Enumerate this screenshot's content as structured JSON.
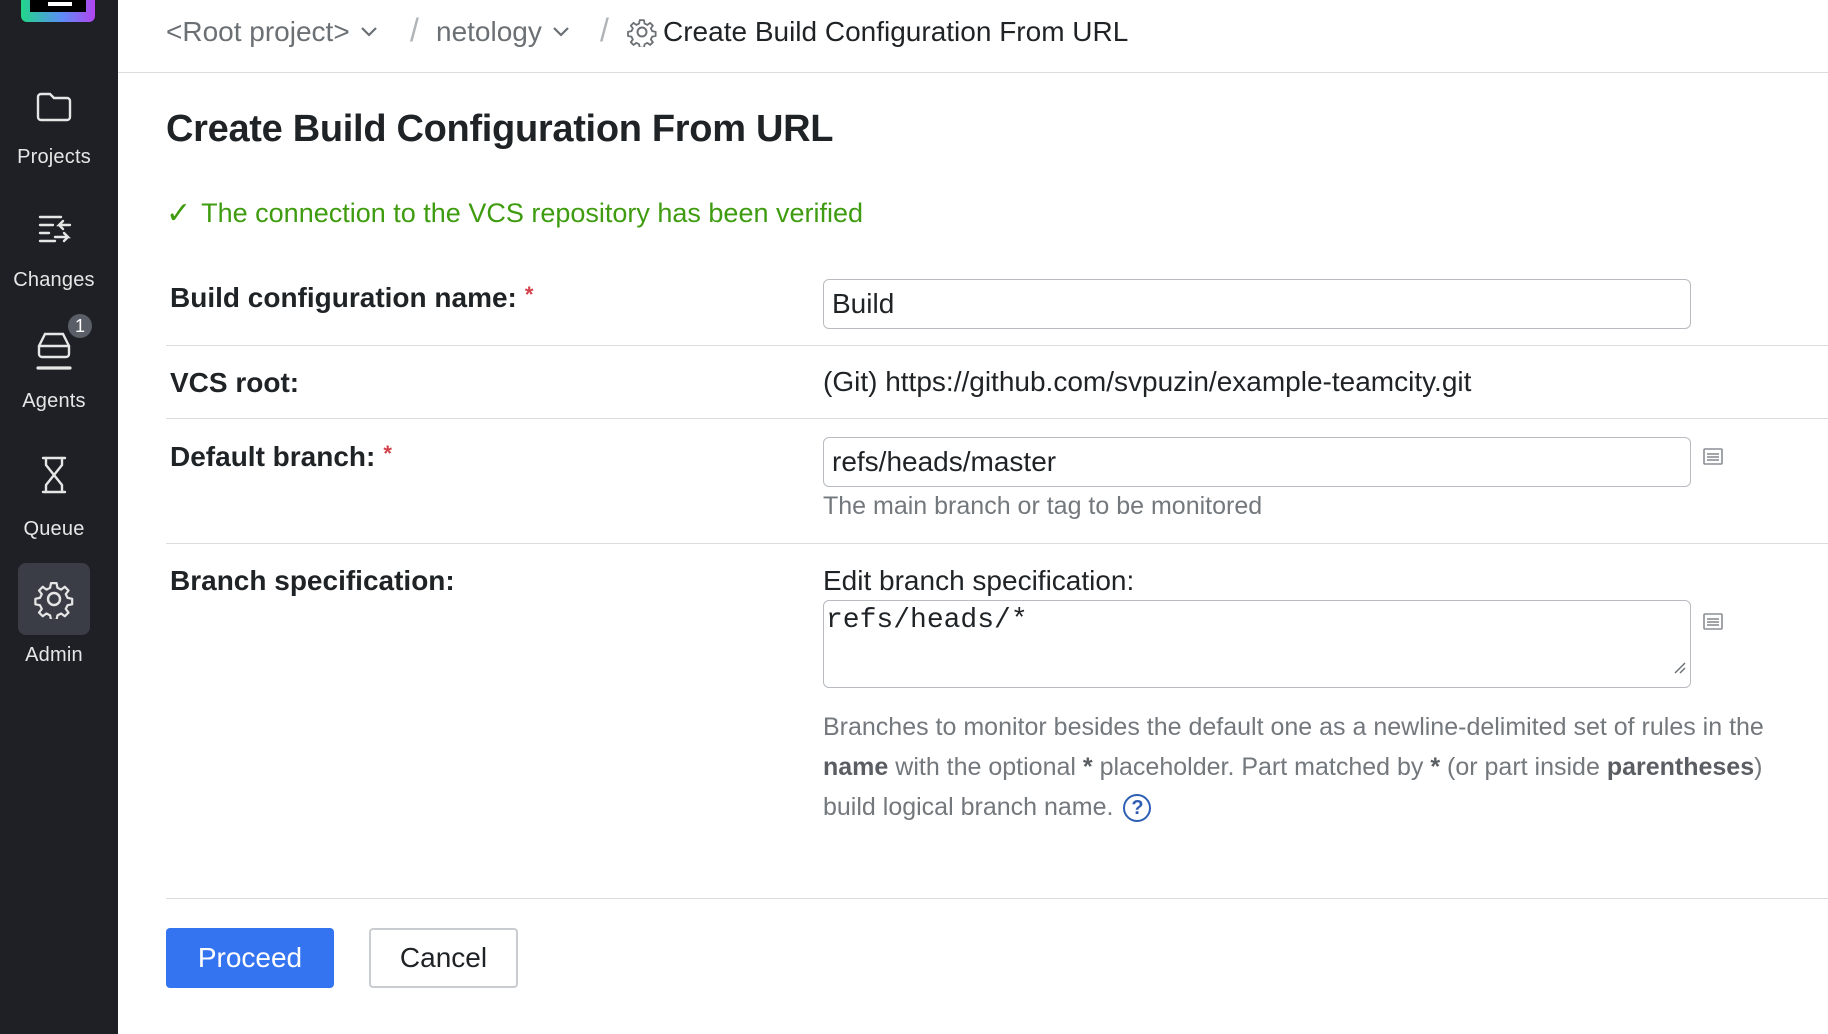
{
  "sidebar": {
    "items": [
      {
        "label": "Projects",
        "icon": "folder-icon"
      },
      {
        "label": "Changes",
        "icon": "changes-icon"
      },
      {
        "label": "Agents",
        "icon": "agent-icon",
        "badge": "1"
      },
      {
        "label": "Queue",
        "icon": "hourglass-icon"
      },
      {
        "label": "Admin",
        "icon": "gear-icon",
        "active": true
      }
    ]
  },
  "breadcrumb": {
    "root": "<Root project>",
    "project": "netology",
    "current": "Create Build Configuration From URL",
    "separator": "/"
  },
  "page": {
    "title": "Create Build Configuration From URL",
    "verified_check": "✓",
    "verified_message": "The connection to the VCS repository has been verified"
  },
  "form": {
    "required_mark": "*",
    "build_name": {
      "label": "Build configuration name:",
      "value": "Build"
    },
    "vcs_root": {
      "label": "VCS root:",
      "value": "(Git) https://github.com/svpuzin/example-teamcity.git"
    },
    "default_branch": {
      "label": "Default branch:",
      "value": "refs/heads/master",
      "hint": "The main branch or tag to be monitored"
    },
    "branch_spec": {
      "label": "Branch specification:",
      "sub_label": "Edit branch specification:",
      "value": "refs/heads/*",
      "desc_line1": "Branches to monitor besides the default one as a newline-delimited set of rules in the",
      "desc_line2_bold1": "name",
      "desc_line2_mid": " with the optional ",
      "desc_line2_bold2": "*",
      "desc_line2_mid2": " placeholder. Part matched by ",
      "desc_line2_bold3": "*",
      "desc_line2_mid3": " (or part inside ",
      "desc_line2_bold4": "parentheses",
      "desc_line2_end": ")",
      "desc_line3": "build logical branch name.",
      "help": "?"
    }
  },
  "actions": {
    "proceed": "Proceed",
    "cancel": "Cancel"
  },
  "colors": {
    "sidebar_bg": "#1e2026",
    "accent": "#3574f0",
    "success": "#3f9c10",
    "required": "#d3424b"
  }
}
